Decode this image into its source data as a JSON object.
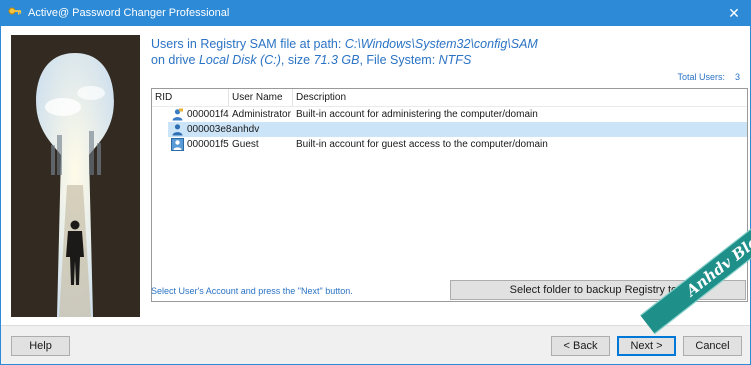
{
  "window": {
    "title": "Active@ Password Changer Professional",
    "close_glyph": "✕"
  },
  "info": {
    "line1_prefix": "Users in Registry SAM file at path: ",
    "sam_path": "C:\\Windows\\System32\\config\\SAM",
    "line2_prefix": "on drive ",
    "drive": "Local Disk (C:)",
    "size_prefix": ", size ",
    "size": "71.3 GB",
    "fs_prefix": ", File System: ",
    "fs": "NTFS"
  },
  "total_users": {
    "label": "Total Users:",
    "count": "3"
  },
  "table": {
    "columns": [
      "RID",
      "User Name",
      "Description"
    ],
    "rows": [
      {
        "rid": "000001f4",
        "user": "Administrator",
        "description": "Built-in account for administering the computer/domain",
        "icon": "admin-user-icon",
        "selected": false
      },
      {
        "rid": "000003e8",
        "user": "anhdv",
        "description": "",
        "icon": "user-icon",
        "selected": true
      },
      {
        "rid": "000001f5",
        "user": "Guest",
        "description": "Built-in account for guest access to the computer/domain",
        "icon": "guest-user-icon",
        "selected": false
      }
    ]
  },
  "hint": "Select User's Account and press the \"Next\" button.",
  "buttons": {
    "backup": "Select folder to backup Registry to...",
    "help": "Help",
    "back": "< Back",
    "next": "Next >",
    "cancel": "Cancel"
  },
  "watermark": "Anhdv Blog",
  "colors": {
    "titlebar": "#2d8ad6",
    "accent_text": "#2b73c4",
    "selection": "#cce4f7",
    "watermark": "#1f8f8a"
  }
}
